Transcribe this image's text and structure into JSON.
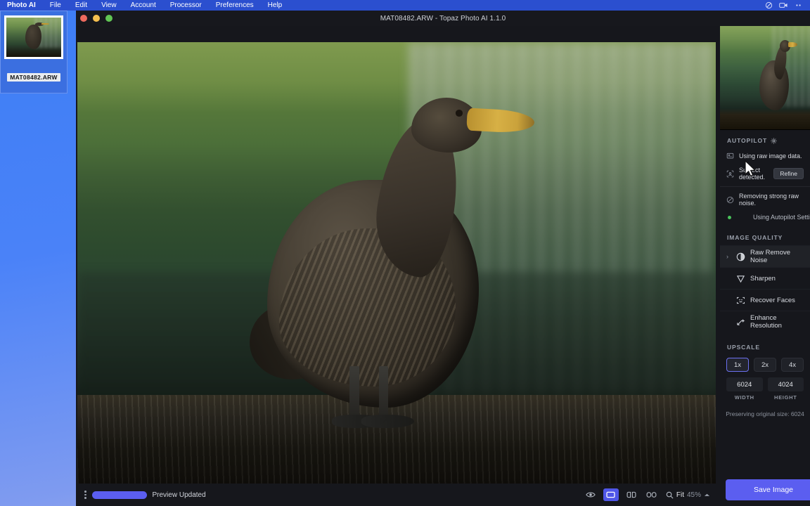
{
  "menubar": {
    "app": "Photo AI",
    "items": [
      "File",
      "Edit",
      "View",
      "Account",
      "Processor",
      "Preferences",
      "Help"
    ],
    "status_icons": [
      "do-not-disturb-icon",
      "screen-record-icon",
      "control-center-icon"
    ]
  },
  "window": {
    "title": "MAT08482.ARW - Topaz Photo AI 1.1.0"
  },
  "filmstrip": {
    "thumbnail_caption": "MAT08482.ARW"
  },
  "bottombar": {
    "menu_icon": "kebab-menu-icon",
    "progress_label": "Preview Updated",
    "progress_percent": 100,
    "view_icons": [
      "eye-icon",
      "single-view-icon",
      "split-view-icon",
      "side-by-side-icon"
    ],
    "zoom_icon": "magnifier-icon",
    "zoom_mode": "Fit",
    "zoom_percent": "45%",
    "zoom_caret": "caret-up-icon"
  },
  "rightpanel": {
    "navigator_label": "navigator-preview",
    "autopilot": {
      "heading": "AUTOPILOT",
      "gear_icon": "gear-icon",
      "rows": [
        {
          "icon": "raw-file-icon",
          "text": "Using raw image data."
        },
        {
          "icon": "subject-detect-icon",
          "text": "Subject detected.",
          "action": "Refine"
        },
        {
          "icon": "noise-icon",
          "text": "Removing strong raw noise."
        }
      ],
      "footer": "Using Autopilot Settings"
    },
    "image_quality": {
      "heading": "IMAGE QUALITY",
      "rows": [
        {
          "icon": "remove-noise-icon",
          "label": "Raw Remove Noise",
          "expandable": true,
          "active": true
        },
        {
          "icon": "sharpen-icon",
          "label": "Sharpen",
          "expandable": false,
          "active": false
        },
        {
          "icon": "recover-faces-icon",
          "label": "Recover Faces",
          "expandable": false,
          "active": false
        },
        {
          "icon": "enhance-resolution-icon",
          "label": "Enhance Resolution",
          "expandable": false,
          "active": false
        }
      ]
    },
    "upscale": {
      "heading": "UPSCALE",
      "options": [
        "1x",
        "2x",
        "4x"
      ],
      "selected": "1x",
      "width_value": "6024",
      "width_label": "WIDTH",
      "height_value": "4024",
      "height_label": "HEIGHT",
      "note": "Preserving original size: 6024"
    },
    "save_button": "Save Image"
  },
  "colors": {
    "accent": "#5b5ef0",
    "panel_bg": "#16171c",
    "desktop_blue": "#3d7ef5",
    "status_green": "#49c35b"
  }
}
